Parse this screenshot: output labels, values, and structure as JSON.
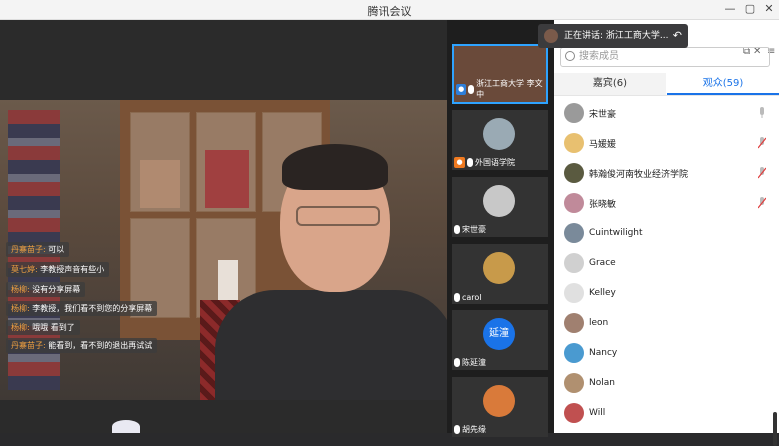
{
  "window": {
    "title": "腾讯会议",
    "minimize": "—",
    "restore": "▢",
    "close": "✕"
  },
  "main_video": {
    "speaker": "浙江工商大学 李文中"
  },
  "chat": [
    {
      "name": "丹寨苗子:",
      "text": " 可以"
    },
    {
      "name": "莫七婷:",
      "text": " 李教授声音有些小"
    },
    {
      "name": "杨柳:",
      "text": " 没有分享屏幕"
    },
    {
      "name": "杨柳:",
      "text": " 李教授，我们看不到您的分享屏幕"
    },
    {
      "name": "杨柳:",
      "text": " 哦哦 看到了"
    },
    {
      "name": "丹寨苗子:",
      "text": " 能看到，看不到的退出再试试"
    }
  ],
  "gallery": [
    {
      "name": "浙江工商大学 李文中",
      "badge": "user",
      "color": "#6a4a3a"
    },
    {
      "name": "外国语学院",
      "badge": "host",
      "color": "#9aaab4"
    },
    {
      "name": "宋世豪",
      "badge": "",
      "color": "#c8c8c8"
    },
    {
      "name": "carol",
      "badge": "",
      "color": "#c89a4a"
    },
    {
      "name": "陈延潼",
      "badge": "",
      "color": "#1a73e8",
      "text": "延潼"
    },
    {
      "name": "胡先缘",
      "badge": "",
      "color": "#d97a3a"
    }
  ],
  "toast": {
    "text": "正在讲话: 浙江工商大学...",
    "back": "↶"
  },
  "panel": {
    "search_placeholder": "搜索成员",
    "tab_guest": "嘉宾(6)",
    "tab_audience": "观众(59)",
    "members": [
      {
        "name": "宋世豪",
        "color": "#9a9a9a",
        "mic": "on"
      },
      {
        "name": "马媛媛",
        "color": "#e8c070",
        "mic": "muted"
      },
      {
        "name": "韩瀚俊河南牧业经济学院",
        "color": "#5a5a40",
        "mic": "muted"
      },
      {
        "name": "张晓敏",
        "color": "#c08a9a",
        "mic": "muted"
      },
      {
        "name": "Cuintwilight",
        "color": "#7a8a9a",
        "mic": ""
      },
      {
        "name": "Grace",
        "color": "#d0d0d0",
        "mic": ""
      },
      {
        "name": "Kelley",
        "color": "#e0e0e0",
        "mic": ""
      },
      {
        "name": "leon",
        "color": "#a08070",
        "mic": ""
      },
      {
        "name": "Nancy",
        "color": "#4a9ad0",
        "mic": ""
      },
      {
        "name": "Nolan",
        "color": "#b09070",
        "mic": ""
      },
      {
        "name": "Will",
        "color": "#c05050",
        "mic": ""
      }
    ]
  }
}
